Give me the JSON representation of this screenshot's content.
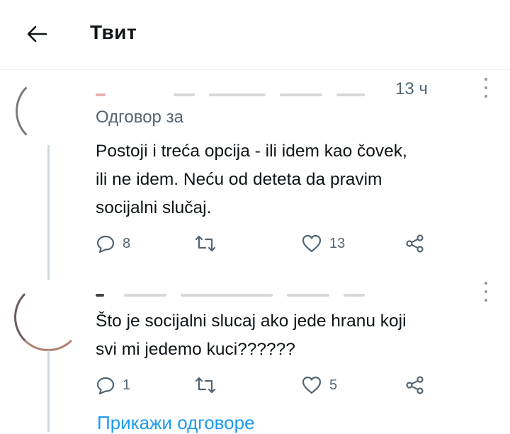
{
  "header": {
    "title": "Твит"
  },
  "tweets": [
    {
      "time": "13 ч",
      "reply_to": "Одговор за",
      "text_lines": [
        "Postoji i treća opcija - ili idem kao čovek,",
        "ili ne idem. Neću od deteta da pravim",
        "socijalni slučaj."
      ],
      "replies": "8",
      "likes": "13"
    },
    {
      "text_lines": [
        "Što je socijalni slucaj ako jede hranu koji",
        "svi mi jedemo kuci??????"
      ],
      "replies": "1",
      "likes": "5"
    }
  ],
  "show_replies_label": "Прикажи одговоре",
  "colors": {
    "accent": "#1d9bf0",
    "secondary_text": "#536471",
    "divider": "#e6ecf0"
  },
  "icons": [
    "back-arrow-icon",
    "more-icon",
    "reply-icon",
    "retweet-icon",
    "like-icon",
    "share-icon"
  ]
}
